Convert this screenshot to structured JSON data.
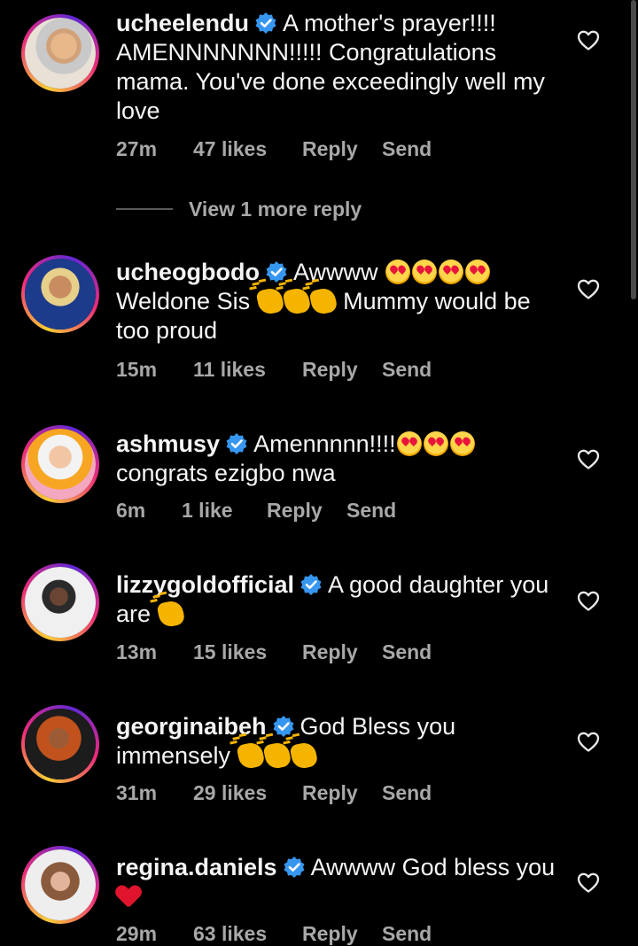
{
  "colors": {
    "background": "#000000",
    "text": "#f5f5f5",
    "muted": "#a8a8a8",
    "verified": "#3797f0"
  },
  "icons": {
    "verified": "verified-badge-icon",
    "like": "heart-outline-icon"
  },
  "comments": [
    {
      "username": "ucheelendu",
      "verified": true,
      "text_parts": [
        "A mother's prayer!!!! AMENNNNNNN!!!!! Congratulations mama. You've done exceedingly well my love"
      ],
      "time": "27m",
      "likes": "47 likes",
      "reply": "Reply",
      "send": "Send",
      "view_more": "View 1 more reply"
    },
    {
      "username": "ucheogbodo",
      "verified": true,
      "text_a": "Awwww",
      "text_b": "Weldone Sis",
      "text_c": "Mummy would be too proud",
      "time": "15m",
      "likes": "11 likes",
      "reply": "Reply",
      "send": "Send"
    },
    {
      "username": "ashmusy",
      "verified": true,
      "text_a": "Amennnnn!!!!",
      "text_b": "congrats ezigbo nwa",
      "time": "6m",
      "likes": "1 like",
      "reply": "Reply",
      "send": "Send"
    },
    {
      "username": "lizzygoldofficial",
      "verified": true,
      "text_a": "A good daughter you are",
      "time": "13m",
      "likes": "15 likes",
      "reply": "Reply",
      "send": "Send"
    },
    {
      "username": "georginaibeh",
      "verified": true,
      "text_a": "God Bless you immensely",
      "time": "31m",
      "likes": "29 likes",
      "reply": "Reply",
      "send": "Send"
    },
    {
      "username": "regina.daniels",
      "verified": true,
      "text_a": "Awwww God bless you",
      "time": "29m",
      "likes": "63 likes",
      "reply": "Reply",
      "send": "Send"
    }
  ]
}
